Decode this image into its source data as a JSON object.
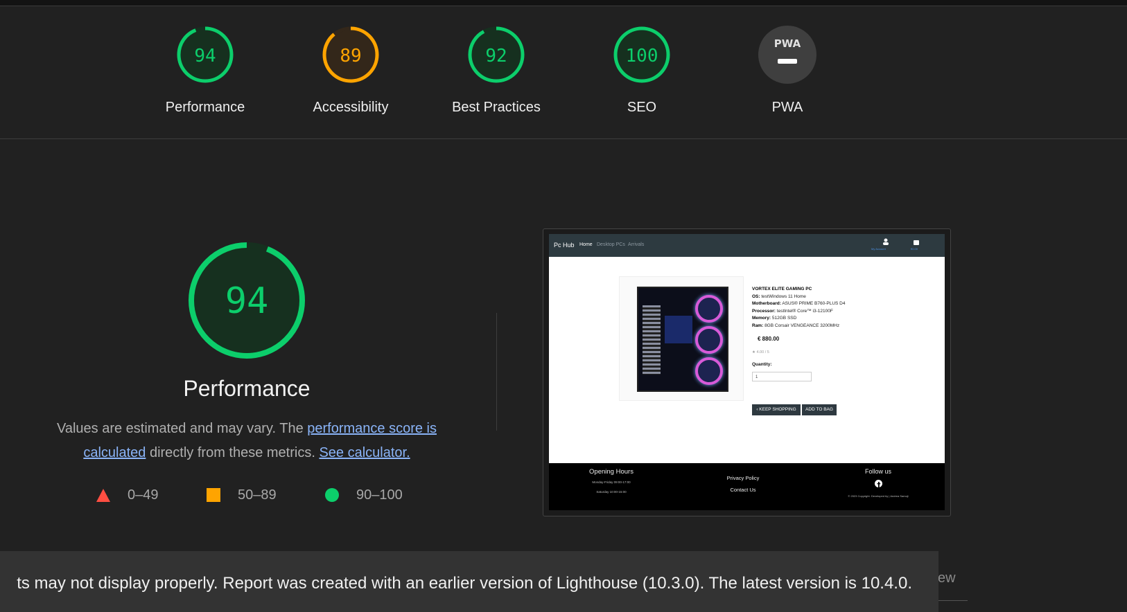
{
  "scores": [
    {
      "value": "94",
      "label": "Performance",
      "color": "#0cce6b",
      "fraction": 0.94
    },
    {
      "value": "89",
      "label": "Accessibility",
      "color": "#ffa400",
      "fraction": 0.89
    },
    {
      "value": "92",
      "label": "Best Practices",
      "color": "#0cce6b",
      "fraction": 0.92
    },
    {
      "value": "100",
      "label": "SEO",
      "color": "#0cce6b",
      "fraction": 1.0
    },
    {
      "value": "PWA",
      "label": "PWA",
      "color": "#3f3f3f"
    }
  ],
  "performance": {
    "score": "94",
    "fraction": 0.94,
    "title": "Performance",
    "desc_pre": "Values are estimated and may vary. The ",
    "desc_link1": "performance score is calculated",
    "desc_mid": " directly from these metrics. ",
    "desc_link2": "See calculator.",
    "legend": [
      {
        "range": "0–49",
        "shape": "triangle-icon",
        "color": "#ff4e42"
      },
      {
        "range": "50–89",
        "shape": "square-icon",
        "color": "#ffa400"
      },
      {
        "range": "90–100",
        "shape": "circle-icon",
        "color": "#0cce6b"
      }
    ]
  },
  "screenshot": {
    "brand": "Pc Hub",
    "nav": [
      "Home",
      "Desktop PCs",
      "Arrivals"
    ],
    "account_label": "My Account",
    "bag_label": "€0.00",
    "product_title": "VORTEX ELITE GAMING PC",
    "specs": [
      {
        "k": "OS:",
        "v": " testWindows 11 Home"
      },
      {
        "k": "Motherboard:",
        "v": " ASUS® PRIME B760-PLUS D4"
      },
      {
        "k": "Processor:",
        "v": " testIntel® Core™ i3-12100F"
      },
      {
        "k": "Memory:",
        "v": " 512GB SSD"
      },
      {
        "k": "Ram:",
        "v": " 8GB Corsair VENGEANCE 3200MHz"
      }
    ],
    "price": "€ 880.00",
    "rating": "★ 4.00 / 5",
    "quantity_label": "Quantity:",
    "quantity_value": "1",
    "keep_shopping": "‹ KEEP SHOPPING",
    "add_to_bag": "ADD TO BAG",
    "footer": {
      "hours_title": "Opening Hours",
      "hours_1": "Monday-Friday 09:00-17:00",
      "hours_2": "Saturday 10:00-15:00",
      "privacy": "Privacy Policy",
      "contact": "Contact Us",
      "follow": "Follow us",
      "copyright": "© 2023 Copyright. Developed by | Andrea Samoji"
    }
  },
  "toast": {
    "message": "ts may not display properly. Report was created with an earlier version of Lighthouse (10.3.0). The latest version is 10.4.0."
  },
  "behind_text": "ew"
}
